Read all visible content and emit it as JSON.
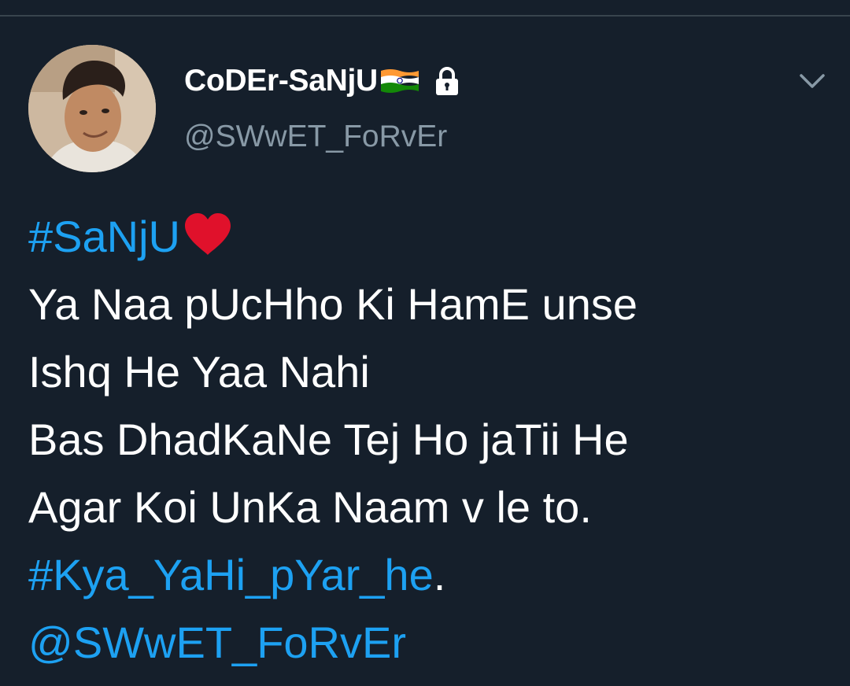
{
  "tweet": {
    "display_name": "CoDEr-SaNjU",
    "handle": "@SWwET_FoRvEr",
    "icons": {
      "flag": "india-flag-icon",
      "lock": "lock-icon",
      "menu": "chevron-down-icon",
      "heart": "red-heart-icon"
    },
    "body": {
      "hashtag_1": "#SaNjU",
      "line_1": "Ya Naa pUcHho Ki HamE unse",
      "line_2": "Ishq He Yaa Nahi",
      "line_3": "Bas DhadKaNe Tej Ho jaTii He",
      "line_4": "Agar Koi UnKa Naam v le to.",
      "hashtag_2": "#Kya_YaHi_pYar_he",
      "hashtag_2_suffix": ".",
      "mention": "@SWwET_FoRvEr"
    }
  },
  "colors": {
    "background": "#151f2b",
    "text": "#ffffff",
    "secondary_text": "#8899a6",
    "link": "#1da1f2",
    "heart": "#e0112b"
  }
}
